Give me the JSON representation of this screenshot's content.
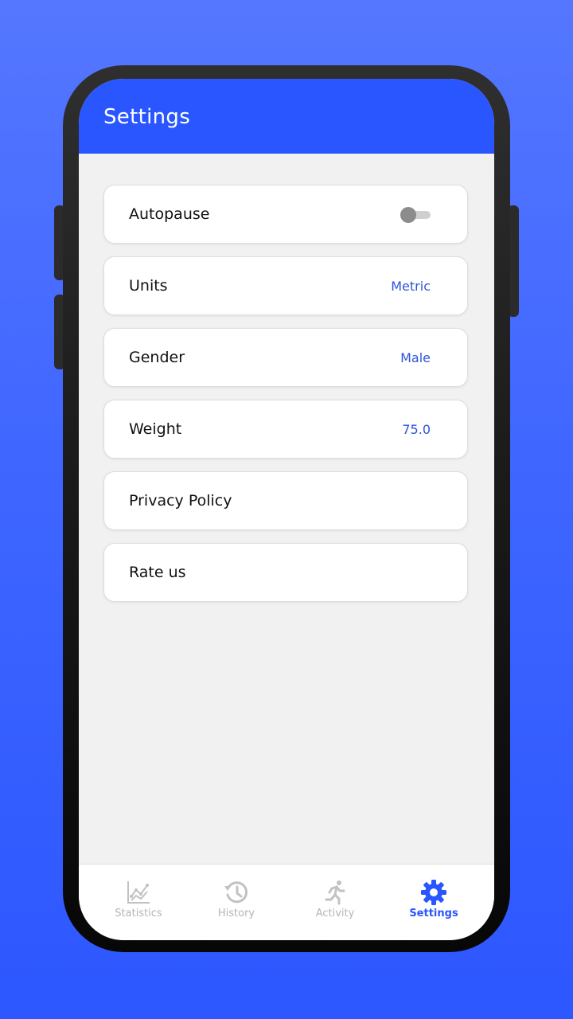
{
  "header": {
    "title": "Settings"
  },
  "settings": {
    "items": [
      {
        "label": "Autopause",
        "type": "toggle",
        "toggle_on": false
      },
      {
        "label": "Units",
        "value": "Metric"
      },
      {
        "label": "Gender",
        "value": "Male"
      },
      {
        "label": "Weight",
        "value": "75.0"
      },
      {
        "label": "Privacy Policy"
      },
      {
        "label": "Rate us"
      }
    ]
  },
  "bottom_nav": {
    "items": [
      {
        "label": "Statistics",
        "icon": "chart-icon",
        "active": false
      },
      {
        "label": "History",
        "icon": "history-icon",
        "active": false
      },
      {
        "label": "Activity",
        "icon": "running-icon",
        "active": false
      },
      {
        "label": "Settings",
        "icon": "gear-icon",
        "active": true
      }
    ]
  },
  "colors": {
    "accent": "#2a56ff",
    "value_text": "#2c55d8",
    "inactive_nav": "#b5b5b5",
    "background_gradient_top": "#5577ff",
    "background_gradient_bottom": "#2d57ff"
  }
}
